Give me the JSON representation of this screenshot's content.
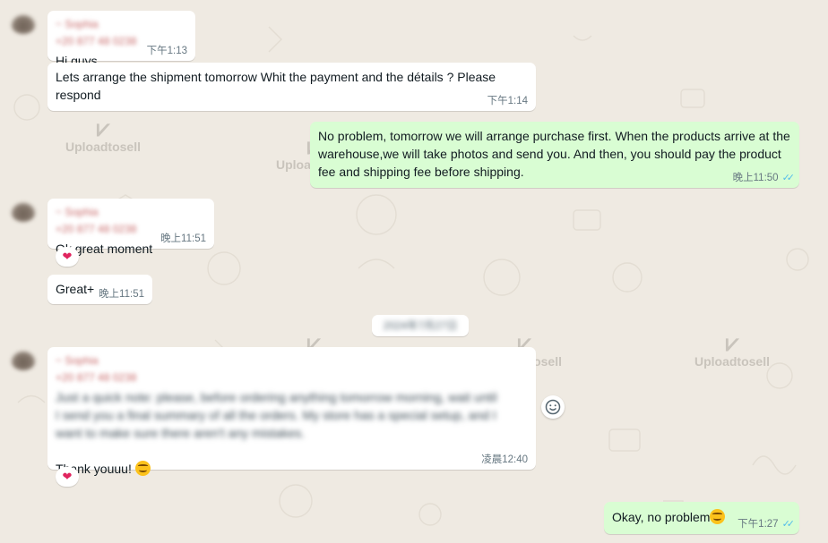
{
  "watermark": "Uploadtosell",
  "messages": [
    {
      "id": "m1",
      "sender": "~ Sophia",
      "phone": "+20 877 48 0238",
      "text": "Hi guys",
      "time": "下午1:13"
    },
    {
      "id": "m2",
      "text": "Lets arrange the shipment tomorrow Whit the payment and the détails ? Please respond",
      "time": "下午1:14"
    },
    {
      "id": "m3",
      "text": "No problem, tomorrow we will arrange purchase first. When the products arrive at the warehouse,we will take photos and send you. And then, you should pay the product fee and shipping fee before shipping.",
      "time": "晚上11:50"
    },
    {
      "id": "m4",
      "sender": "~ Sophia",
      "phone": "+20 877 48 0238",
      "text": "Ok great moment",
      "time": "晚上11:51",
      "reaction": "❤"
    },
    {
      "id": "m5",
      "text": "Great+",
      "time": "晚上11:51"
    },
    {
      "id": "m6",
      "sender": "~ Sophia",
      "phone": "+20 877 48 0238",
      "blurred_text": "Just a quick note: please, before ordering anything tomorrow morning, wait until I send you a final summary of all the orders. My store has a special setup, and I want to make sure there aren't any mistakes.",
      "text": "Thank youuu!",
      "time": "凌晨12:40",
      "reaction": "❤"
    },
    {
      "id": "m7",
      "text": "Okay, no problem",
      "time": "下午1:27"
    }
  ],
  "date_divider": "2024年7月27日",
  "colors": {
    "incoming": "#ffffff",
    "outgoing": "#d9fdd3",
    "read_ticks": "#53bdeb",
    "background": "#efeae2"
  }
}
